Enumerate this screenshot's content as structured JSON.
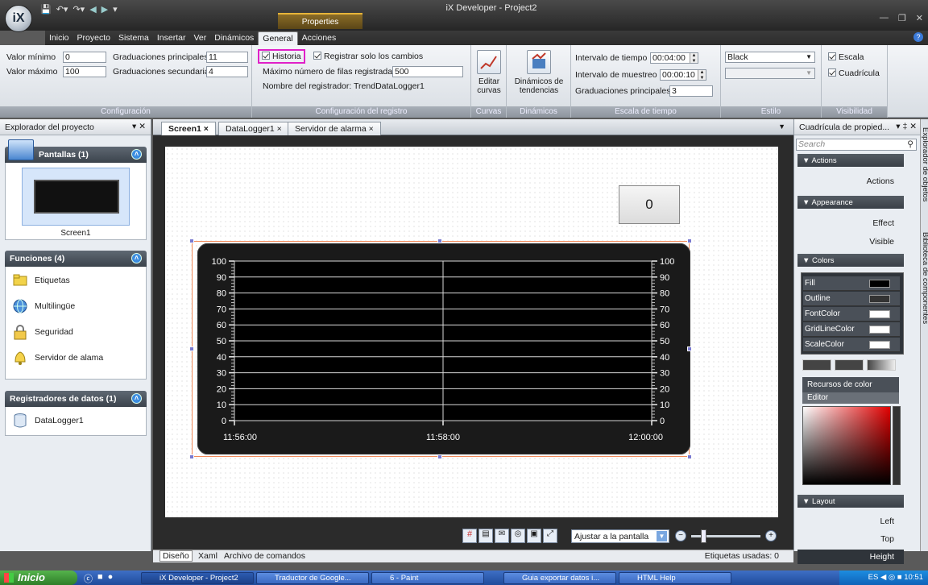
{
  "window": {
    "title": "iX Developer - Project2",
    "app_button": "iX",
    "context_tab": "Properties"
  },
  "menu": [
    "Inicio",
    "Proyecto",
    "Sistema",
    "Insertar",
    "Ver",
    "Dinámicos",
    "General",
    "Acciones"
  ],
  "ribbon": {
    "config": {
      "min_label": "Valor mínimo",
      "min_value": "0",
      "max_label": "Valor máximo",
      "max_value": "100",
      "major_label": "Graduaciones principales",
      "major_value": "11",
      "minor_label": "Graduaciones secundarias",
      "minor_value": "4",
      "caption": "Configuración"
    },
    "logger": {
      "history_label": "Historia",
      "only_changes_label": "Registrar solo los cambios",
      "max_rows_label": "Máximo número de filas registradas",
      "max_rows_value": "500",
      "logger_name_label": "Nombre del registrador:",
      "logger_name_value": "TrendDataLogger1",
      "caption": "Configuración del registro"
    },
    "curves": {
      "button": "Editar curvas",
      "caption": "Curvas"
    },
    "dyn": {
      "button": "Dinámicos de tendencias",
      "caption": "Dinámicos"
    },
    "time": {
      "interval_label": "Intervalo de tiempo",
      "interval_value": "00:04:00",
      "sample_label": "Intervalo de muestreo",
      "sample_value": "00:00:10",
      "major_label": "Graduaciones principales",
      "major_value": "3",
      "caption": "Escala de tiempo"
    },
    "style": {
      "color_value": "Black",
      "caption": "Estilo"
    },
    "vis": {
      "scale_label": "Escala",
      "grid_label": "Cuadrícula",
      "caption": "Visibilidad"
    }
  },
  "left": {
    "title": "Explorador del proyecto",
    "screens_header": "Pantallas (1)",
    "screen_name": "Screen1",
    "functions_header": "Funciones (4)",
    "functions": [
      "Etiquetas",
      "Multilingüe",
      "Seguridad",
      "Servidor de alama"
    ],
    "loggers_header": "Registradores de datos (1)",
    "logger": "DataLogger1"
  },
  "doc": {
    "tabs": [
      "Screen1",
      "DataLogger1",
      "Servidor de alarma"
    ],
    "numeric_value": "0",
    "zoom_option": "Ajustar a la pantalla",
    "bottom_tabs": [
      "Diseño",
      "Xaml",
      "Archivo de comandos"
    ],
    "tags_used": "Etiquetas usadas: 0"
  },
  "chart_data": {
    "type": "line",
    "y_ticks": [
      "100",
      "90",
      "80",
      "70",
      "60",
      "50",
      "40",
      "30",
      "20",
      "10",
      "0"
    ],
    "x_ticks": [
      "11:56:00",
      "11:58:00",
      "12:00:00"
    ],
    "ylim": [
      0,
      100
    ],
    "grid": true,
    "series": []
  },
  "right": {
    "title": "Cuadrícula de propied...",
    "search_placeholder": "Search",
    "actions_header": "Actions",
    "actions_item": "Actions",
    "appearance_header": "Appearance",
    "effect": "Effect",
    "visible": "Visible",
    "colors_header": "Colors",
    "colors": [
      {
        "name": "Fill",
        "hex": "#000000"
      },
      {
        "name": "Outline",
        "hex": "#333333"
      },
      {
        "name": "FontColor",
        "hex": "#ffffff"
      },
      {
        "name": "GridLineColor",
        "hex": "#ffffff"
      },
      {
        "name": "ScaleColor",
        "hex": "#ffffff"
      }
    ],
    "color_resources": "Recursos de color",
    "editor": "Editor",
    "layout_header": "Layout",
    "left": "Left",
    "top": "Top",
    "height": "Height",
    "side_tabs": [
      "Explorador de objetos",
      "Biblioteca de componentes"
    ]
  },
  "taskbar": {
    "start": "Inicio",
    "tasks": [
      "iX Developer - Project2",
      "Traductor de Google...",
      "6 - Paint",
      "Guia exportar datos i...",
      "HTML Help"
    ],
    "lang": "ES",
    "time": "10:51"
  },
  "colors": {
    "highlight": "#e020c8",
    "selection": "#f08a5a",
    "handle": "#7a7ad0"
  }
}
